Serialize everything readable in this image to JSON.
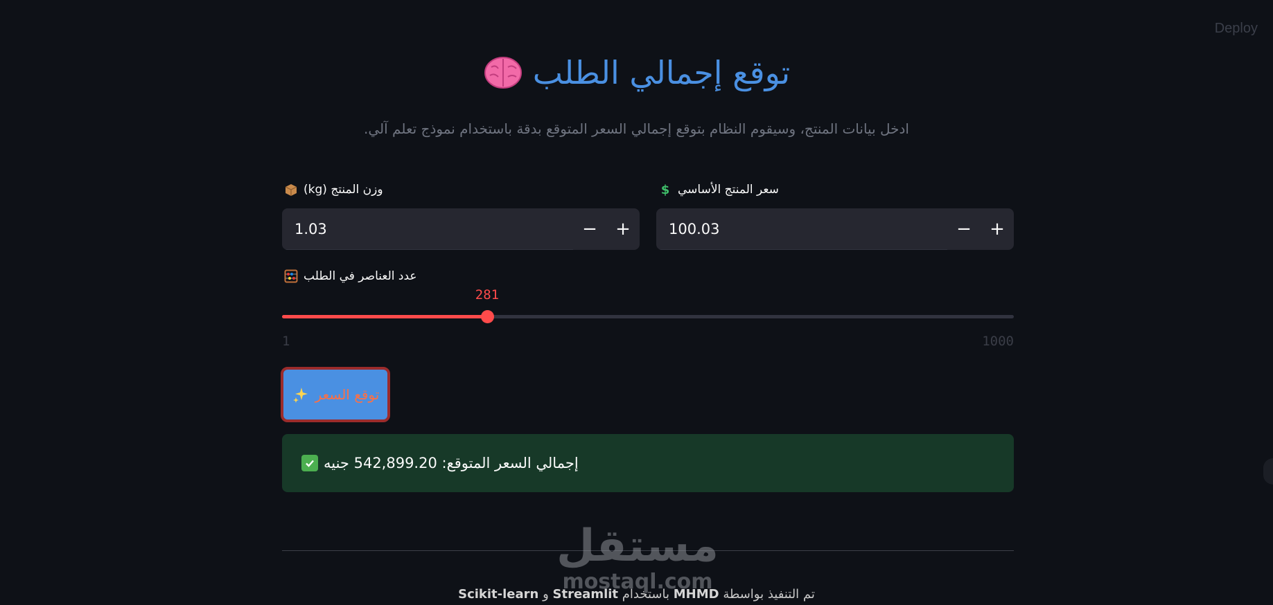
{
  "header": {
    "deploy_label": "Deploy"
  },
  "page": {
    "title": "توقع إجمالي الطلب",
    "title_icon": "brain-icon",
    "subtitle": "ادخل بيانات المنتج، وسيقوم النظام بتوقع إجمالي السعر المتوقع بدقة باستخدام نموذج تعلم آلي."
  },
  "inputs": {
    "weight": {
      "label": "وزن المنتج (kg)",
      "icon": "package-icon",
      "value": "1.03",
      "minus": "−",
      "plus": "+"
    },
    "price": {
      "label": "سعر المنتج الأساسي",
      "icon": "dollar-icon",
      "value": "100.03",
      "minus": "−",
      "plus": "+"
    }
  },
  "slider": {
    "label": "عدد العناصر في الطلب",
    "icon": "abacus-icon",
    "value": 281,
    "value_label": "281",
    "min": 1,
    "max": 1000,
    "min_label": "1",
    "max_label": "1000",
    "accent": "#ff4b4b"
  },
  "predict_button": {
    "label": "توقع السعر",
    "icon": "sparkles-icon"
  },
  "result": {
    "icon": "check-icon",
    "text": "إجمالي السعر المتوقع: 542,899.20 جنيه"
  },
  "footer": {
    "prefix": "تم التنفيذ بواسطة",
    "author": "MHMD",
    "middle": "باستخدام",
    "tool1": "Streamlit",
    "conj": "و",
    "tool2": "Scikit-learn"
  },
  "watermark": {
    "arabic": "مستقل",
    "latin": "mostaql.com"
  },
  "colors": {
    "background": "#0e1117",
    "title": "#4a90e2",
    "input_bg": "#262730",
    "success_bg": "#173928"
  }
}
